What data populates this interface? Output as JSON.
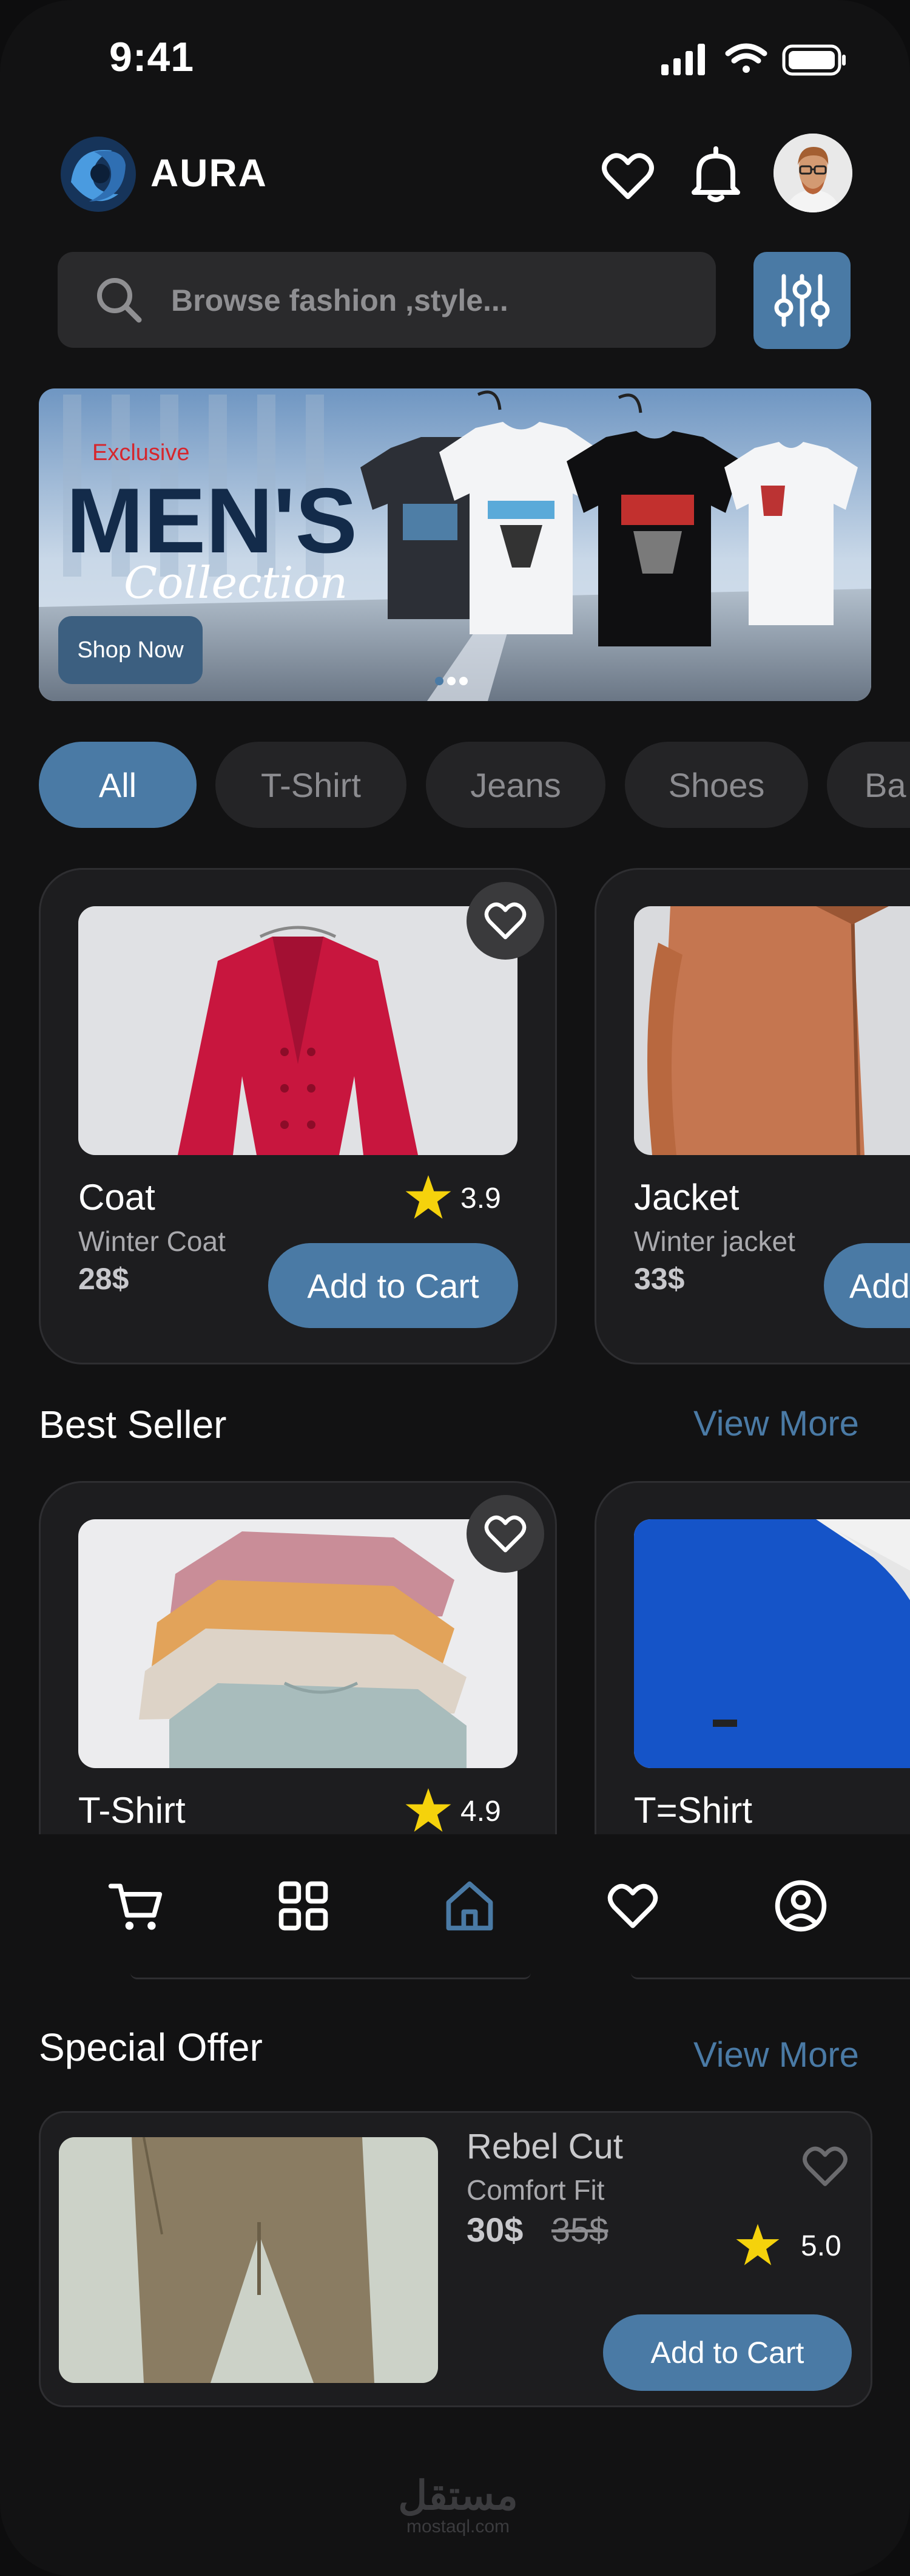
{
  "status": {
    "time": "9:41"
  },
  "header": {
    "brand": "AURA"
  },
  "search": {
    "placeholder": "Browse fashion ,style..."
  },
  "banner": {
    "kicker": "Exclusive",
    "title": "MEN'S",
    "script": "Collection",
    "button": "Shop Now",
    "active_slide": 0,
    "slide_count": 3
  },
  "categories": [
    {
      "label": "All",
      "active": true
    },
    {
      "label": "T-Shirt",
      "active": false
    },
    {
      "label": "Jeans",
      "active": false
    },
    {
      "label": "Shoes",
      "active": false
    },
    {
      "label": "Ba",
      "active": false
    }
  ],
  "products": [
    {
      "name": "Coat",
      "subtitle": "Winter Coat",
      "price": "28$",
      "rating": "3.9",
      "button": "Add to Cart",
      "image": "red-coat"
    },
    {
      "name": "Jacket",
      "subtitle": "Winter jacket",
      "price": "33$",
      "rating": "",
      "button": "Add",
      "image": "orange-jacket"
    }
  ],
  "best_seller": {
    "title": "Best Seller",
    "view_more": "View More",
    "items": [
      {
        "name": "T-Shirt",
        "rating": "4.9",
        "image": "stacked-tshirts"
      },
      {
        "name": "T=Shirt",
        "image": "blue-tshirt"
      }
    ]
  },
  "bottom_nav": {
    "items": [
      "cart-icon",
      "grid-icon",
      "home-icon",
      "heart-icon",
      "profile-icon"
    ],
    "active": "home-icon"
  },
  "special_offer": {
    "title": "Special Offer",
    "view_more": "View More",
    "item": {
      "name": "Rebel Cut",
      "subtitle": "Comfort Fit",
      "price": "30$",
      "old_price": "35$",
      "rating": "5.0",
      "button": "Add to Cart"
    }
  },
  "watermark": {
    "arabic": "مستقل",
    "domain": "mostaql.com"
  },
  "colors": {
    "accent": "#4a7aa5",
    "background": "#121213",
    "card": "#1d1d1f",
    "star": "#f5d20c"
  }
}
